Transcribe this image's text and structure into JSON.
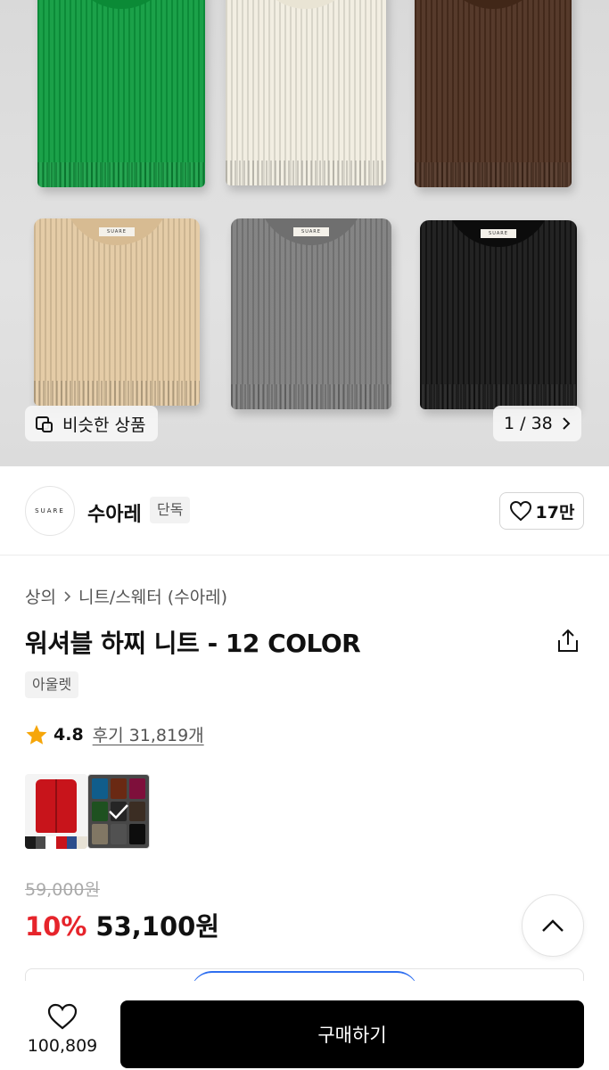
{
  "hero": {
    "similar_label": "비슷한 상품",
    "pager": "1 / 38",
    "sweater_tag": "SUARE",
    "sweater_colors": [
      "#0d9b3e",
      "#f1ede0",
      "#4b2e1e",
      "#e3c9a2",
      "#7d7d7d",
      "#151515"
    ]
  },
  "brand": {
    "logo_text": "SUARE",
    "name": "수아레",
    "badge": "단독",
    "likes": "17만"
  },
  "product": {
    "breadcrumb": [
      "상의",
      "니트/스웨터 (수아레)"
    ],
    "title": "워셔블 하찌 니트 - 12 COLOR",
    "tag": "아울렛",
    "rating": "4.8",
    "reviews": "후기 31,819개",
    "original_price": "59,000원",
    "discount": "10%",
    "price": "53,100원"
  },
  "thumbnails": {
    "strip_colors": [
      "#1a1a1a",
      "#4a4a4a",
      "#ffffff",
      "#c8141b",
      "#2b4d8c",
      "#e7e2d6"
    ],
    "swatch_colors": [
      "#1a8fd6",
      "#a3401e",
      "#c2185b",
      "#2e7d32",
      "#3a3a3a",
      "#5b4636",
      "#c7b79a",
      "#7d7d7d",
      "#151515"
    ]
  },
  "bottom": {
    "wish_count": "100,809",
    "buy_label": "구매하기"
  },
  "colors": {
    "accent_red": "#e6242b",
    "buy_button": "#000000"
  }
}
